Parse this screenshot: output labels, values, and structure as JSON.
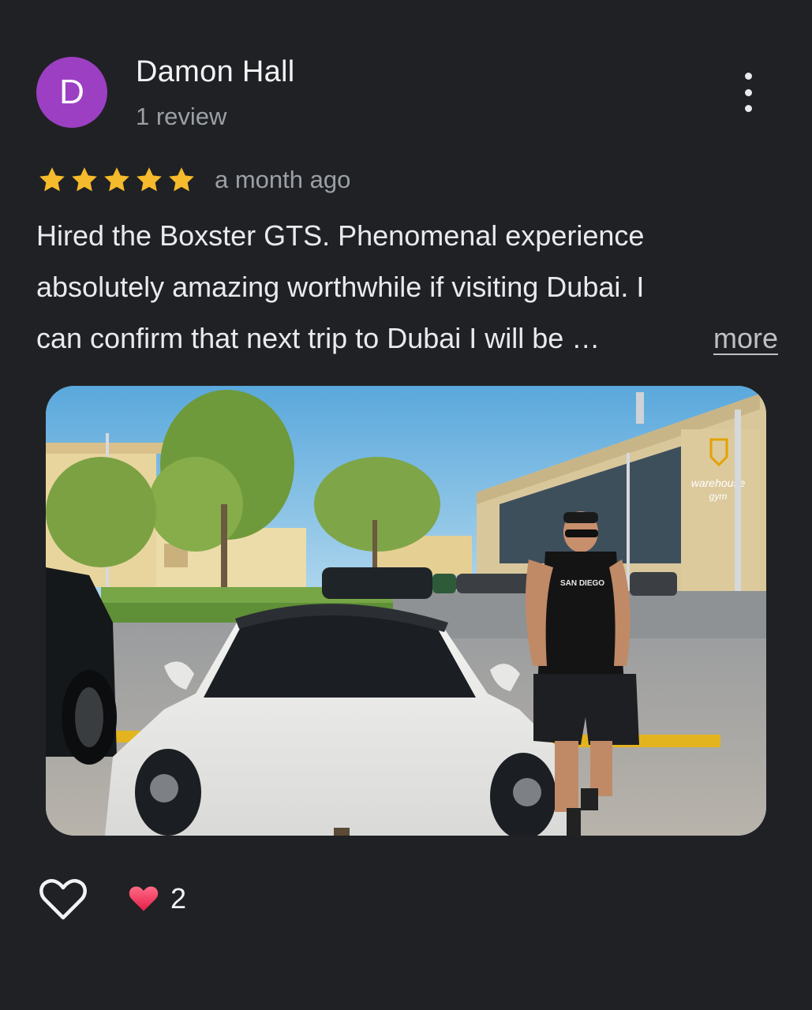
{
  "author": {
    "initial": "D",
    "name": "Damon Hall",
    "review_count": "1 review",
    "avatar_color": "#9c3fc3"
  },
  "review": {
    "rating": 5,
    "max_rating": 5,
    "star_color": "#f6bb2c",
    "time": "a month ago",
    "text_lines": [
      "Hired the Boxster GTS. Phenomenal experience",
      "absolutely amazing worthwhile if visiting Dubai. I",
      "can confirm that next trip to Dubai I will be …"
    ],
    "more_label": "more"
  },
  "photo": {
    "building_sign": "warehouse gym",
    "shirt_text": "SAN DIEGO"
  },
  "reactions": {
    "like_icon": "heart-outline-icon",
    "reaction_icon": "red-heart-icon",
    "count": "2"
  }
}
